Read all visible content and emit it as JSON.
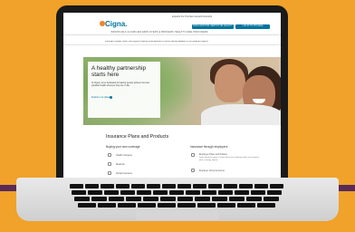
{
  "colors": {
    "background": "#f0a22a",
    "stripe_purple": "#5b2b58",
    "brand": "#00749e",
    "brand_accent": "#f58220"
  },
  "site": {
    "logo_text": "Cigna.",
    "toplinks": "Español   For Providers   Español   Español",
    "buttons": [
      "FIND A DOCTOR, DENTIST OR FACILITY",
      "LOG IN TO MYCIGNA"
    ],
    "nav": "INDIVIDUALS & FAMILIES     EMPLOYERS & BROKERS     HEALTH CARE PROVIDERS",
    "alert": "Important Update: Learn how Cigna is helping those affected by recent natural disasters in the impacted regions"
  },
  "hero": {
    "title": "A healthy partnership starts here",
    "text": "At Cigna, we're dedicated to helping people achieve the best possible health wherever they are in life.",
    "link": "Explore our plans"
  },
  "section": {
    "title": "Insurance Plans and Products",
    "left": {
      "heading": "Buying your own coverage",
      "items": [
        "Health Insurance",
        "Medicare",
        "Dental Insurance"
      ]
    },
    "right": {
      "heading": "Insurance through employers",
      "items": [
        "Employee Plans and Policies",
        "Employer Group Accounts"
      ],
      "subtext": "Learn about the types of Cigna plans your employer offers and compare your coverage options"
    }
  }
}
